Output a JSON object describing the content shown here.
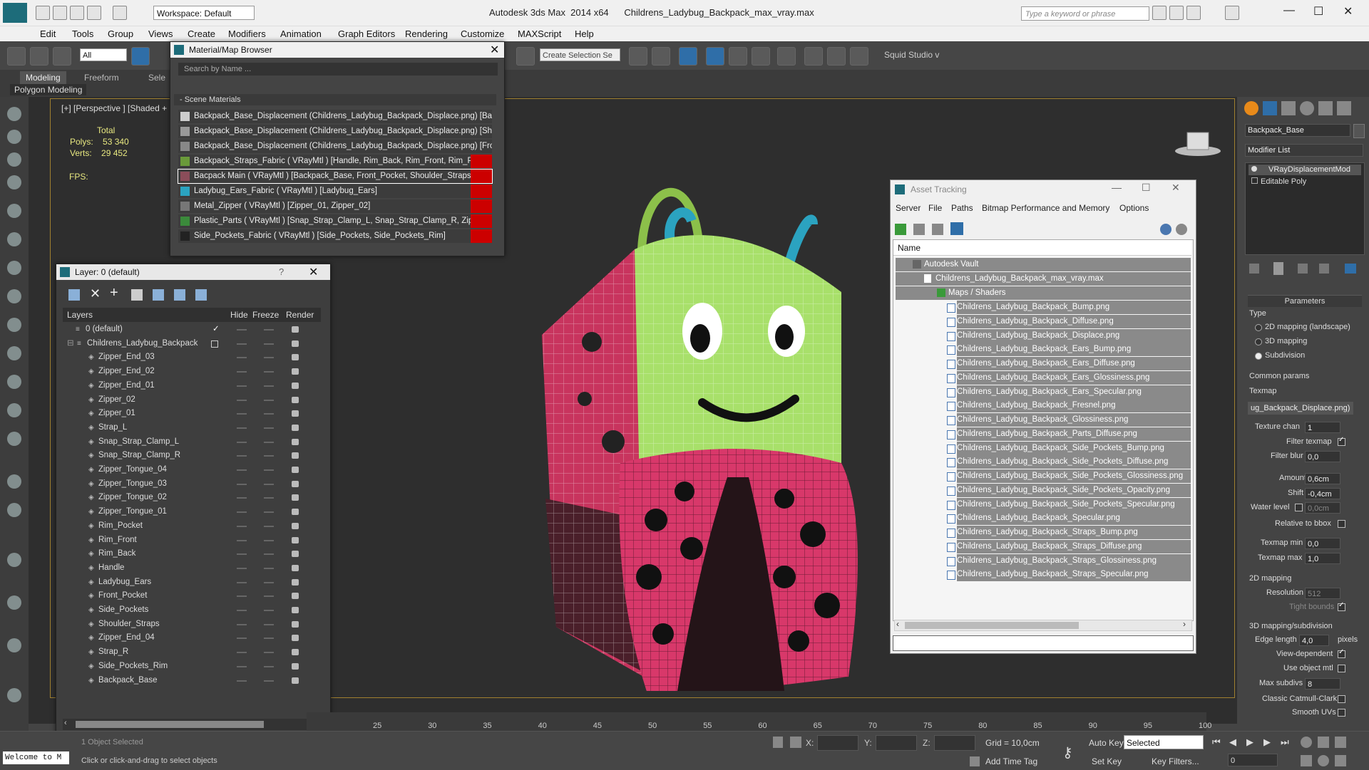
{
  "titlebar": {
    "title": "Autodesk 3ds Max  2014 x64      Childrens_Ladybug_Backpack_max_vray.max",
    "workspace": "Workspace: Default",
    "search_placeholder": "Type a keyword or phrase"
  },
  "menu": [
    "Edit",
    "Tools",
    "Group",
    "Views",
    "Create",
    "Modifiers",
    "Animation",
    "Graph Editors",
    "Rendering",
    "Customize",
    "MAXScript",
    "Help"
  ],
  "toolbar": {
    "selection_filter": "All",
    "create_selection_set": "Create Selection Se",
    "squid_studio": "Squid Studio v"
  },
  "ribbon": {
    "tabs": [
      "Modeling",
      "Freeform",
      "Sele"
    ],
    "sub_label": "Polygon Modeling"
  },
  "viewport": {
    "label": "[+] [Perspective ] [Shaded +",
    "stats_header": "Total",
    "polys_label": "Polys:",
    "polys_value": "53 340",
    "verts_label": "Verts:",
    "verts_value": "29 452",
    "fps_label": "FPS:"
  },
  "material_browser": {
    "title": "Material/Map Browser",
    "search_placeholder": "Search by Name ...",
    "section": "- Scene Materials",
    "items": [
      "Backpack_Base_Displacement (Childrens_Ladybug_Backpack_Displace.png) [Bac...",
      "Backpack_Base_Displacement (Childrens_Ladybug_Backpack_Displace.png) [Sh...",
      "Backpack_Base_Displacement (Childrens_Ladybug_Backpack_Displace.png) [Fro...",
      "Backpack_Straps_Fabric ( VRayMtl ) [Handle, Rim_Back, Rim_Front, Rim_Pocke...",
      "Bacpack Main ( VRayMtl ) [Backpack_Base, Front_Pocket, Shoulder_Straps]",
      "Ladybug_Ears_Fabric ( VRayMtl ) [Ladybug_Ears]",
      "Metal_Zipper ( VRayMtl ) [Zipper_01, Zipper_02]",
      "Plastic_Parts ( VRayMtl ) [Snap_Strap_Clamp_L, Snap_Strap_Clamp_R, Zipper_...",
      "Side_Pockets_Fabric ( VRayMtl ) [Side_Pockets, Side_Pockets_Rim]"
    ]
  },
  "layer_panel": {
    "title": "Layer: 0 (default)",
    "help": "?",
    "col_layers": "Layers",
    "col_hide": "Hide",
    "col_freeze": "Freeze",
    "col_render": "Render",
    "rows": [
      "0 (default)",
      "Childrens_Ladybug_Backpack",
      "Zipper_End_03",
      "Zipper_End_02",
      "Zipper_End_01",
      "Zipper_02",
      "Zipper_01",
      "Strap_L",
      "Snap_Strap_Clamp_L",
      "Snap_Strap_Clamp_R",
      "Zipper_Tongue_04",
      "Zipper_Tongue_03",
      "Zipper_Tongue_02",
      "Zipper_Tongue_01",
      "Rim_Pocket",
      "Rim_Front",
      "Rim_Back",
      "Handle",
      "Ladybug_Ears",
      "Front_Pocket",
      "Side_Pockets",
      "Shoulder_Straps",
      "Zipper_End_04",
      "Strap_R",
      "Side_Pockets_Rim",
      "Backpack_Base"
    ]
  },
  "asset_tracking": {
    "title": "Asset Tracking",
    "menu": [
      "Server",
      "File",
      "Paths",
      "Bitmap Performance and Memory",
      "Options"
    ],
    "col_name": "Name",
    "vault": "Autodesk Vault",
    "file": "Childrens_Ladybug_Backpack_max_vray.max",
    "maps_folder": "Maps / Shaders",
    "maps": [
      "Childrens_Ladybug_Backpack_Bump.png",
      "Childrens_Ladybug_Backpack_Diffuse.png",
      "Childrens_Ladybug_Backpack_Displace.png",
      "Childrens_Ladybug_Backpack_Ears_Bump.png",
      "Childrens_Ladybug_Backpack_Ears_Diffuse.png",
      "Childrens_Ladybug_Backpack_Ears_Glossiness.png",
      "Childrens_Ladybug_Backpack_Ears_Specular.png",
      "Childrens_Ladybug_Backpack_Fresnel.png",
      "Childrens_Ladybug_Backpack_Glossiness.png",
      "Childrens_Ladybug_Backpack_Parts_Diffuse.png",
      "Childrens_Ladybug_Backpack_Side_Pockets_Bump.png",
      "Childrens_Ladybug_Backpack_Side_Pockets_Diffuse.png",
      "Childrens_Ladybug_Backpack_Side_Pockets_Glossiness.png",
      "Childrens_Ladybug_Backpack_Side_Pockets_Opacity.png",
      "Childrens_Ladybug_Backpack_Side_Pockets_Specular.png",
      "Childrens_Ladybug_Backpack_Specular.png",
      "Childrens_Ladybug_Backpack_Straps_Bump.png",
      "Childrens_Ladybug_Backpack_Straps_Diffuse.png",
      "Childrens_Ladybug_Backpack_Straps_Glossiness.png",
      "Childrens_Ladybug_Backpack_Straps_Specular.png"
    ]
  },
  "command_panel": {
    "object_name": "Backpack_Base",
    "modifier_list": "Modifier List",
    "stack": [
      "VRayDisplacementMod",
      "Editable Poly"
    ],
    "parameters": "Parameters",
    "type_label": "Type",
    "type_options": [
      "2D mapping (landscape)",
      "3D mapping",
      "Subdivision"
    ],
    "common_params": "Common params",
    "texmap_label": "Texmap",
    "texmap_value": "ug_Backpack_Displace.png)",
    "texture_chan_label": "Texture chan",
    "texture_chan_value": "1",
    "filter_texmap_label": "Filter texmap",
    "filter_blur_label": "Filter blur",
    "filter_blur_value": "0,0",
    "amount_label": "Amount",
    "amount_value": "0,6cm",
    "shift_label": "Shift",
    "shift_value": "-0,4cm",
    "water_level_label": "Water level",
    "water_level_value": "0,0cm",
    "relative_bbox_label": "Relative to bbox",
    "texmap_min_label": "Texmap min",
    "texmap_min_value": "0,0",
    "texmap_max_label": "Texmap max",
    "texmap_max_value": "1,0",
    "mapping2d_label": "2D mapping",
    "resolution_label": "Resolution",
    "resolution_value": "512",
    "tight_bounds_label": "Tight bounds",
    "mapping3d_label": "3D mapping/subdivision",
    "edge_length_label": "Edge length",
    "edge_length_value": "4,0",
    "pixels_label": "pixels",
    "view_dependent_label": "View-dependent",
    "use_object_mtl_label": "Use object mtl",
    "max_subdivs_label": "Max subdivs",
    "max_subdivs_value": "8",
    "catmull_label": "Classic Catmull-Clark",
    "smooth_uvs_label": "Smooth UVs"
  },
  "timeline": {
    "ticks": [
      "25",
      "30",
      "35",
      "40",
      "45",
      "50",
      "55",
      "60",
      "65",
      "70",
      "75",
      "80",
      "85",
      "90",
      "95",
      "100"
    ]
  },
  "status": {
    "welcome": "Welcome to M",
    "objects_selected": "1 Object Selected",
    "hint": "Click or click-and-drag to select objects",
    "x": "X:",
    "y": "Y:",
    "z": "Z:",
    "grid": "Grid = 10,0cm",
    "add_time_tag": "Add Time Tag",
    "auto_key": "Auto Key",
    "set_key": "Set Key",
    "selected": "Selected",
    "key_filters": "Key Filters...",
    "frame": "0"
  },
  "colors": {
    "material_red": "#cc0000",
    "asset_row": "#8a8a8a",
    "backpack_green": "#a8e06a",
    "backpack_pink": "#d8386a"
  }
}
